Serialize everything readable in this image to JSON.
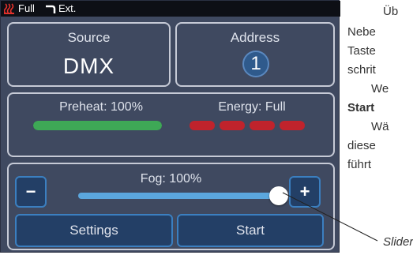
{
  "statusbar": {
    "heat_icon": "heater-coil-icon",
    "full_label": "Full",
    "hose_icon": "hose-icon",
    "ext_label": "Ext."
  },
  "source": {
    "label": "Source",
    "value": "DMX"
  },
  "address": {
    "label": "Address",
    "value": "1"
  },
  "preheat": {
    "label": "Preheat: 100%",
    "level": 1.0,
    "color": "#3ea856"
  },
  "energy": {
    "label": "Energy: Full",
    "segments_on": 4,
    "color": "#c0232c"
  },
  "fog": {
    "label": "Fog: 100%",
    "level": 1.0,
    "minus_label": "−",
    "plus_label": "+",
    "track_color": "#5ba6dd"
  },
  "buttons": {
    "settings_label": "Settings",
    "start_label": "Start"
  },
  "doc_text": {
    "line1": "Üb",
    "line2": "Nebe",
    "line3": "Taste",
    "line4": "schrit",
    "line5": "We",
    "line6": "Start",
    "line7": "Wä",
    "line8": "diese",
    "line9": "führt"
  },
  "caption": "Slider",
  "colors": {
    "device_bg": "#3f4960",
    "button_bg": "#233f66",
    "button_border": "#3b7fc0",
    "statusbar_bg": "#0d0f15"
  }
}
